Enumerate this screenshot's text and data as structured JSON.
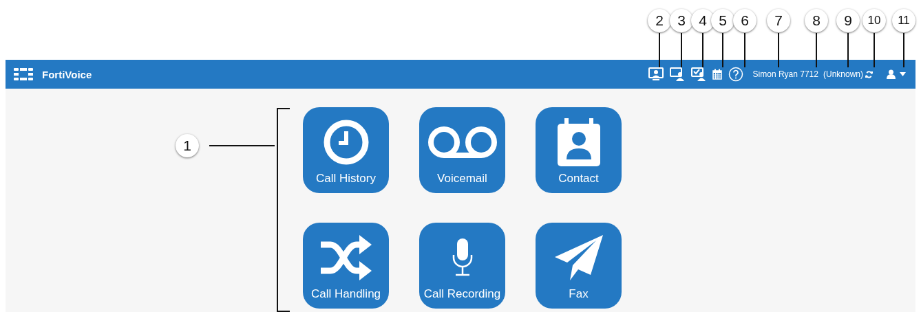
{
  "header": {
    "title": "FortiVoice",
    "user_name": "Simon Ryan 7712",
    "status": "(Unknown)"
  },
  "tiles": [
    {
      "label": "Call History"
    },
    {
      "label": "Voicemail"
    },
    {
      "label": "Contact"
    },
    {
      "label": "Call Handling"
    },
    {
      "label": "Call Recording"
    },
    {
      "label": "Fax"
    }
  ],
  "callouts": [
    "1",
    "2",
    "3",
    "4",
    "5",
    "6",
    "7",
    "8",
    "9",
    "10",
    "11"
  ]
}
